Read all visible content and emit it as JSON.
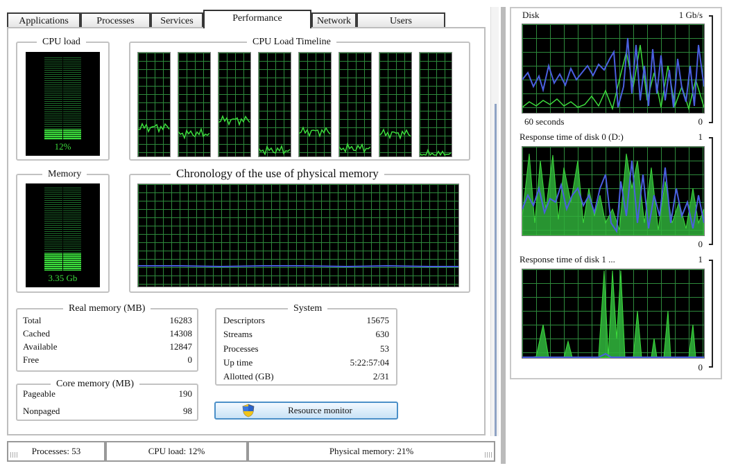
{
  "tabs": [
    {
      "label": "Applications"
    },
    {
      "label": "Processes"
    },
    {
      "label": "Services"
    },
    {
      "label": "Performance"
    },
    {
      "label": "Network"
    },
    {
      "label": "Users"
    }
  ],
  "active_tab": "Performance",
  "cpu": {
    "title": "CPU load",
    "value_label": "12%",
    "level": 0.12
  },
  "cpu_timeline": {
    "title": "CPU Load Timeline",
    "cores": 8,
    "core_levels": [
      0.28,
      0.22,
      0.35,
      0.06,
      0.24,
      0.08,
      0.22,
      0.02
    ]
  },
  "memory": {
    "title": "Memory",
    "value_label": "3.35 Gb",
    "level": 0.21
  },
  "memory_chart": {
    "title": "Chronology of the use of physical memory",
    "level": 0.21
  },
  "real_memory": {
    "title": "Real memory (MB)",
    "rows": [
      {
        "label": "Total",
        "value": "16283"
      },
      {
        "label": "Cached",
        "value": "14308"
      },
      {
        "label": "Available",
        "value": "12847"
      },
      {
        "label": "Free",
        "value": "0"
      }
    ]
  },
  "core_memory": {
    "title": "Core memory (MB)",
    "rows": [
      {
        "label": "Pageable",
        "value": "190"
      },
      {
        "label": "Nonpaged",
        "value": "98"
      }
    ]
  },
  "system": {
    "title": "System",
    "rows": [
      {
        "label": "Descriptors",
        "value": "15675"
      },
      {
        "label": "Streams",
        "value": "630"
      },
      {
        "label": "Processes",
        "value": "53"
      },
      {
        "label": "Up time",
        "value": "5:22:57:04"
      },
      {
        "label": "Allotted (GB)",
        "value": "2/31"
      }
    ]
  },
  "resource_monitor": {
    "label": "Resource monitor",
    "icon": "shield-icon"
  },
  "status_bar": {
    "processes": "Processes: 53",
    "cpu_load": "CPU load: 12%",
    "physical_memory": "Physical memory: 21%"
  },
  "side": {
    "disk": {
      "title": "Disk",
      "scale_top": "1 Gb/s",
      "time_label": "60 seconds",
      "scale_bottom": "0"
    },
    "resp0": {
      "title": "Response time of disk 0 (D:)",
      "scale_top": "1",
      "scale_bottom": "0"
    },
    "resp1": {
      "title": "Response time of disk 1 ...",
      "scale_top": "1",
      "scale_bottom": "0"
    }
  },
  "colors": {
    "grid": "#2e8a3c",
    "trace_green": "#3cdc3c",
    "trace_blue": "#4a5fe0",
    "gauge_fill": "#3cdc3c"
  }
}
